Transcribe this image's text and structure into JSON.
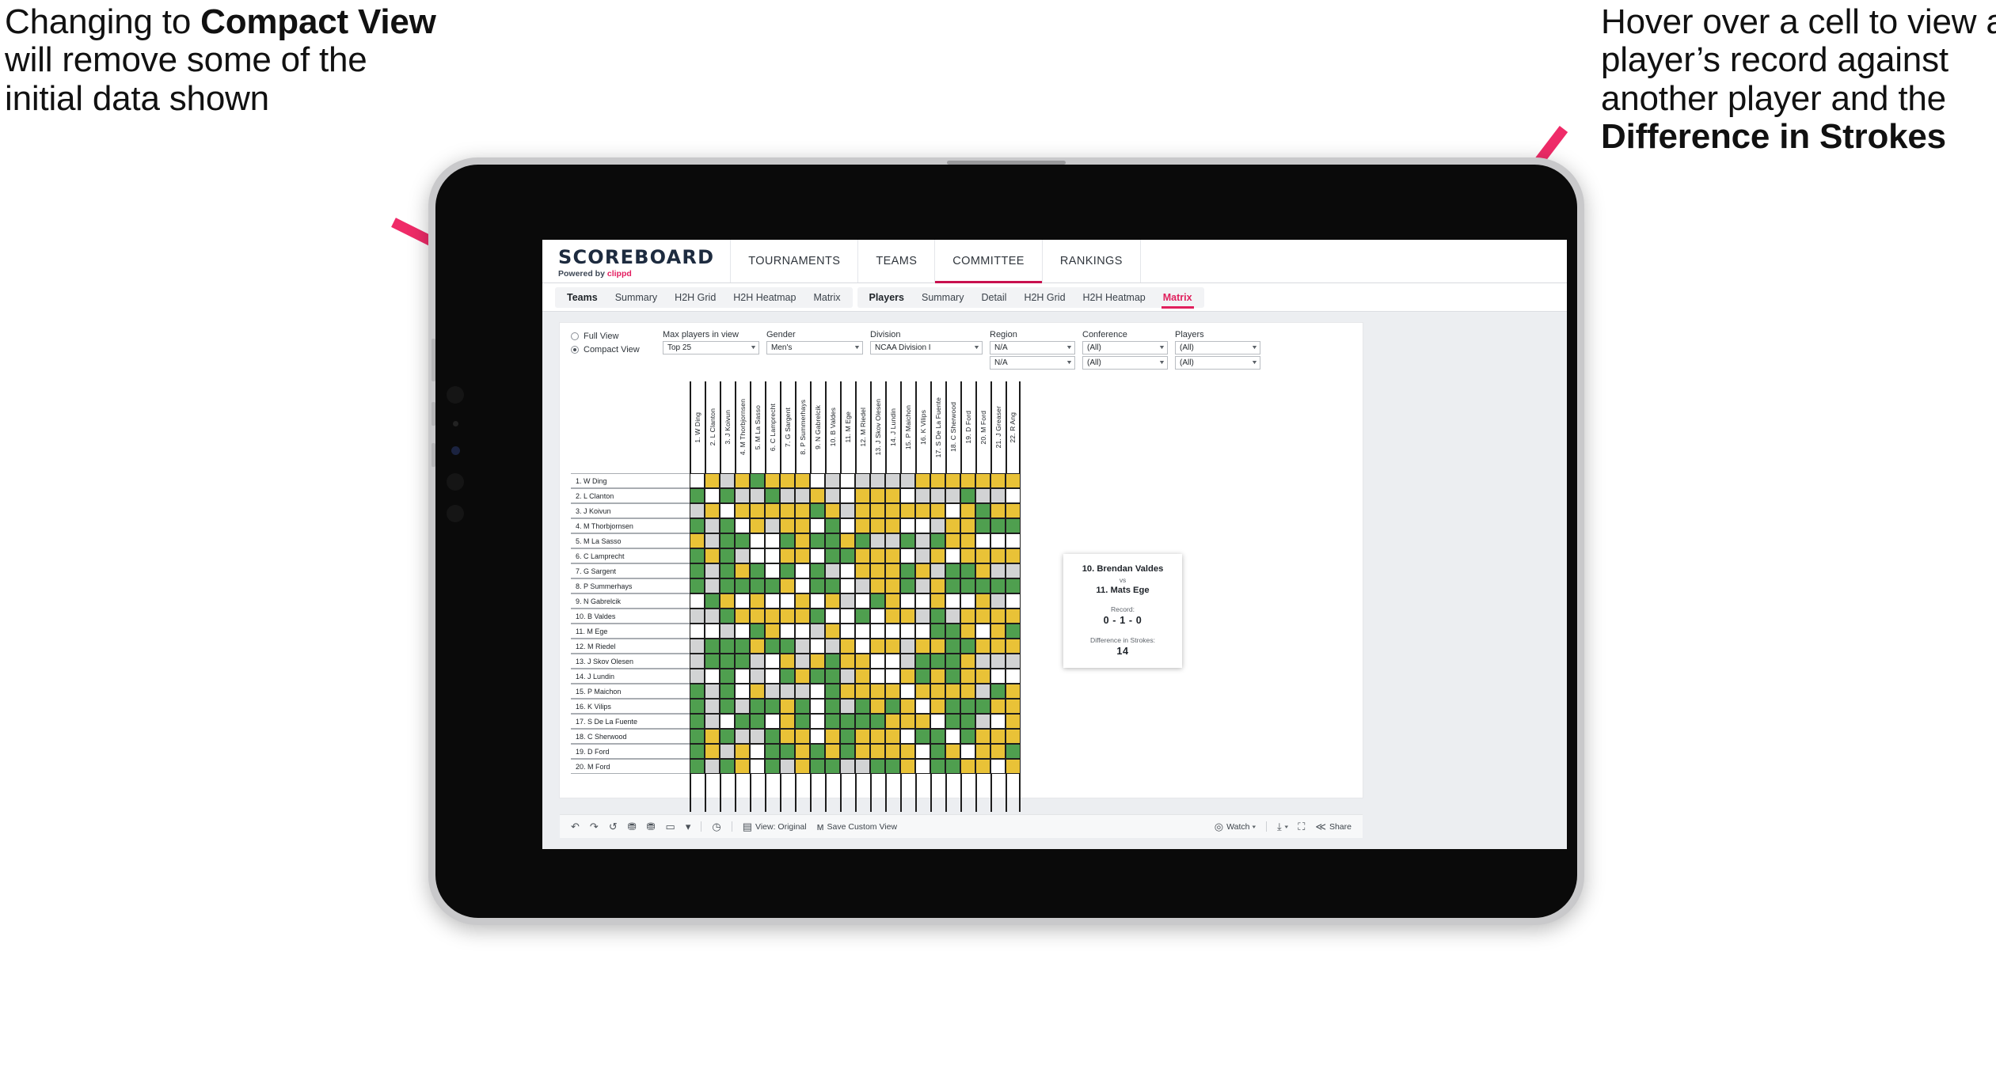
{
  "annotations": {
    "left": {
      "pre": "Changing to ",
      "bold": "Compact View",
      "post": " will remove some of the initial data shown"
    },
    "right": {
      "pre": "Hover over a cell to view a player’s record against another player and the ",
      "bold": "Difference in Strokes",
      "post": ""
    }
  },
  "app": {
    "brand": {
      "name": "SCOREBOARD",
      "powered_prefix": "Powered by ",
      "powered_brand": "clippd"
    },
    "topnav": [
      {
        "label": "TOURNAMENTS",
        "active": false
      },
      {
        "label": "TEAMS",
        "active": false
      },
      {
        "label": "COMMITTEE",
        "active": true
      },
      {
        "label": "RANKINGS",
        "active": false
      }
    ],
    "subnav_group_1": [
      {
        "label": "Teams",
        "strong": true,
        "selected": false
      },
      {
        "label": "Summary",
        "strong": false,
        "selected": false
      },
      {
        "label": "H2H Grid",
        "strong": false,
        "selected": false
      },
      {
        "label": "H2H Heatmap",
        "strong": false,
        "selected": false
      },
      {
        "label": "Matrix",
        "strong": false,
        "selected": false
      }
    ],
    "subnav_group_2": [
      {
        "label": "Players",
        "strong": true,
        "selected": false
      },
      {
        "label": "Summary",
        "strong": false,
        "selected": false
      },
      {
        "label": "Detail",
        "strong": false,
        "selected": false
      },
      {
        "label": "H2H Grid",
        "strong": false,
        "selected": false
      },
      {
        "label": "H2H Heatmap",
        "strong": false,
        "selected": false
      },
      {
        "label": "Matrix",
        "strong": false,
        "selected": true
      }
    ]
  },
  "filters": {
    "view_options": [
      {
        "label": "Full View",
        "selected": false
      },
      {
        "label": "Compact View",
        "selected": true
      }
    ],
    "selects": [
      {
        "name": "max-players-in-view",
        "label": "Max players in view",
        "value": "Top 25",
        "value2": null
      },
      {
        "name": "gender",
        "label": "Gender",
        "value": "Men's",
        "value2": null
      },
      {
        "name": "division",
        "label": "Division",
        "value": "NCAA Division I",
        "value2": null
      },
      {
        "name": "region",
        "label": "Region",
        "value": "N/A",
        "value2": "N/A"
      },
      {
        "name": "conference",
        "label": "Conference",
        "value": "(All)",
        "value2": "(All)"
      },
      {
        "name": "players",
        "label": "Players",
        "value": "(All)",
        "value2": "(All)"
      }
    ]
  },
  "matrix": {
    "column_headers": [
      "1. W Ding",
      "2. L Clanton",
      "3. J Koivun",
      "4. M Thorbjornsen",
      "5. M La Sasso",
      "6. C Lamprecht",
      "7. G Sargent",
      "8. P Summerhays",
      "9. N Gabrelcik",
      "10. B Valdes",
      "11. M Ege",
      "12. M Riedel",
      "13. J Skov Olesen",
      "14. J Lundin",
      "15. P Maichon",
      "16. K Vilips",
      "17. S De La Fuente",
      "18. C Sherwood",
      "19. D Ford",
      "20. M Ford",
      "21. J Greaser",
      "22. R Ang"
    ],
    "row_labels": [
      "1. W Ding",
      "2. L Clanton",
      "3. J Koivun",
      "4. M Thorbjornsen",
      "5. M La Sasso",
      "6. C Lamprecht",
      "7. G Sargent",
      "8. P Summerhays",
      "9. N Gabrelcik",
      "10. B Valdes",
      "11. M Ege",
      "12. M Riedel",
      "13. J Skov Olesen",
      "14. J Lundin",
      "15. P Maichon",
      "16. K Vilips",
      "17. S De La Fuente",
      "18. C Sherwood",
      "19. D Ford",
      "20. M Ford"
    ],
    "legend_colors": {
      "win": "#4f9f4f",
      "tie": "#e9c237",
      "loss": "#d2d3d4",
      "none": "#ffffff"
    },
    "cells": [
      [
        "w",
        "y",
        "a",
        "y",
        "g",
        "y",
        "y",
        "y",
        "w",
        "a",
        "w",
        "a",
        "a",
        "a",
        "a",
        "y",
        "y",
        "y",
        "y",
        "y",
        "y",
        "y"
      ],
      [
        "g",
        "w",
        "g",
        "a",
        "a",
        "g",
        "a",
        "a",
        "y",
        "a",
        "w",
        "y",
        "y",
        "y",
        "w",
        "a",
        "a",
        "a",
        "g",
        "a",
        "a",
        "w"
      ],
      [
        "a",
        "y",
        "w",
        "y",
        "y",
        "y",
        "y",
        "y",
        "g",
        "y",
        "a",
        "y",
        "y",
        "y",
        "y",
        "y",
        "y",
        "w",
        "y",
        "g",
        "y",
        "y"
      ],
      [
        "g",
        "a",
        "g",
        "w",
        "y",
        "a",
        "y",
        "y",
        "w",
        "g",
        "w",
        "y",
        "y",
        "y",
        "w",
        "w",
        "a",
        "y",
        "y",
        "g",
        "g",
        "g"
      ],
      [
        "y",
        "a",
        "g",
        "g",
        "w",
        "w",
        "g",
        "y",
        "g",
        "g",
        "y",
        "g",
        "a",
        "a",
        "g",
        "a",
        "g",
        "y",
        "y",
        "w",
        "w",
        "w"
      ],
      [
        "g",
        "y",
        "g",
        "a",
        "w",
        "w",
        "y",
        "y",
        "w",
        "g",
        "g",
        "y",
        "y",
        "y",
        "w",
        "a",
        "y",
        "w",
        "y",
        "y",
        "y",
        "y"
      ],
      [
        "g",
        "a",
        "g",
        "y",
        "g",
        "w",
        "g",
        "w",
        "g",
        "a",
        "w",
        "y",
        "y",
        "y",
        "g",
        "y",
        "a",
        "g",
        "g",
        "y",
        "a",
        "a"
      ],
      [
        "g",
        "a",
        "g",
        "g",
        "g",
        "g",
        "y",
        "w",
        "g",
        "g",
        "w",
        "a",
        "y",
        "y",
        "g",
        "a",
        "y",
        "g",
        "g",
        "g",
        "g",
        "g"
      ],
      [
        "w",
        "g",
        "y",
        "w",
        "y",
        "w",
        "w",
        "y",
        "w",
        "y",
        "a",
        "w",
        "g",
        "y",
        "w",
        "w",
        "y",
        "w",
        "w",
        "y",
        "a",
        "w"
      ],
      [
        "a",
        "a",
        "g",
        "y",
        "y",
        "y",
        "y",
        "y",
        "g",
        "w",
        "w",
        "g",
        "w",
        "y",
        "y",
        "a",
        "g",
        "a",
        "y",
        "y",
        "y",
        "y"
      ],
      [
        "w",
        "w",
        "a",
        "w",
        "g",
        "y",
        "w",
        "w",
        "a",
        "y",
        "w",
        "w",
        "w",
        "w",
        "w",
        "w",
        "g",
        "g",
        "y",
        "w",
        "y",
        "g"
      ],
      [
        "a",
        "g",
        "g",
        "g",
        "y",
        "g",
        "g",
        "a",
        "w",
        "a",
        "y",
        "w",
        "y",
        "y",
        "a",
        "y",
        "y",
        "g",
        "g",
        "y",
        "y",
        "y"
      ],
      [
        "a",
        "g",
        "g",
        "g",
        "a",
        "w",
        "y",
        "a",
        "y",
        "g",
        "y",
        "y",
        "w",
        "w",
        "a",
        "g",
        "g",
        "g",
        "y",
        "a",
        "a",
        "a"
      ],
      [
        "a",
        "w",
        "g",
        "w",
        "a",
        "w",
        "g",
        "y",
        "g",
        "g",
        "a",
        "y",
        "w",
        "w",
        "y",
        "g",
        "y",
        "g",
        "y",
        "y",
        "w",
        "w"
      ],
      [
        "g",
        "a",
        "g",
        "w",
        "y",
        "a",
        "a",
        "a",
        "w",
        "g",
        "y",
        "y",
        "y",
        "y",
        "w",
        "y",
        "y",
        "y",
        "y",
        "a",
        "g",
        "y"
      ],
      [
        "g",
        "a",
        "g",
        "a",
        "g",
        "g",
        "y",
        "g",
        "w",
        "g",
        "a",
        "g",
        "y",
        "g",
        "y",
        "w",
        "y",
        "g",
        "g",
        "g",
        "y",
        "y"
      ],
      [
        "g",
        "a",
        "w",
        "g",
        "g",
        "w",
        "y",
        "g",
        "w",
        "g",
        "g",
        "g",
        "g",
        "y",
        "y",
        "y",
        "w",
        "g",
        "g",
        "a",
        "w",
        "y"
      ],
      [
        "g",
        "y",
        "g",
        "a",
        "a",
        "g",
        "y",
        "y",
        "w",
        "y",
        "g",
        "y",
        "y",
        "y",
        "w",
        "g",
        "g",
        "w",
        "g",
        "y",
        "y",
        "y"
      ],
      [
        "g",
        "y",
        "a",
        "y",
        "w",
        "g",
        "g",
        "y",
        "g",
        "y",
        "g",
        "y",
        "y",
        "y",
        "y",
        "w",
        "g",
        "y",
        "w",
        "y",
        "y",
        "g"
      ],
      [
        "g",
        "a",
        "g",
        "y",
        "w",
        "g",
        "a",
        "y",
        "g",
        "g",
        "a",
        "a",
        "g",
        "g",
        "y",
        "w",
        "g",
        "g",
        "y",
        "y",
        "w",
        "y"
      ]
    ]
  },
  "tooltip": {
    "player_a": "10. Brendan Valdes",
    "vs": "vs",
    "player_b": "11. Mats Ege",
    "record_label": "Record:",
    "record_value": "0 - 1 - 0",
    "strokes_label": "Difference in Strokes:",
    "strokes_value": "14"
  },
  "toolbar": {
    "icons": [
      {
        "name": "undo-icon",
        "glyph": "↶"
      },
      {
        "name": "redo-icon",
        "glyph": "↷"
      },
      {
        "name": "revert-icon",
        "glyph": "↺"
      },
      {
        "name": "refresh-data-icon",
        "glyph": "⛃"
      },
      {
        "name": "pause-updates-icon",
        "glyph": "⛃"
      },
      {
        "name": "zoom-tool-icon",
        "glyph": "▭"
      },
      {
        "name": "zoom-caret-icon",
        "glyph": "▾"
      }
    ],
    "clock_icon": "◷",
    "items": [
      {
        "name": "view-original",
        "icon": "▤",
        "label": "View: Original"
      },
      {
        "name": "save-custom-view",
        "icon": "ᴍ",
        "label": "Save Custom View"
      }
    ],
    "right_items": [
      {
        "name": "watch",
        "icon": "◎",
        "label": "Watch",
        "caret": "▾"
      },
      {
        "name": "download",
        "icon": "⤓",
        "label": "",
        "caret": "▾"
      },
      {
        "name": "fullscreen",
        "icon": "⛶",
        "label": "",
        "caret": ""
      },
      {
        "name": "share",
        "icon": "≪",
        "label": "Share",
        "caret": ""
      }
    ]
  },
  "colors": {
    "accent_pink": "#e0205d",
    "arrow_pink": "#ef2b68",
    "brand_dark": "#1d2b3f"
  }
}
